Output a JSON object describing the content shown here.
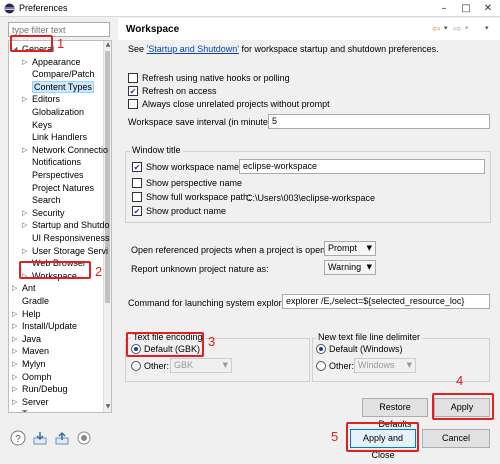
{
  "window": {
    "title": "Preferences",
    "controls": [
      "–",
      "□",
      "✕"
    ]
  },
  "filter": {
    "placeholder": "type filter text"
  },
  "tree": {
    "items": [
      {
        "label": "General",
        "indent": 0,
        "arrow": "◢",
        "selected": false,
        "annot": "1"
      },
      {
        "label": "Appearance",
        "indent": 1,
        "arrow": "▷"
      },
      {
        "label": "Compare/Patch",
        "indent": 1,
        "arrow": ""
      },
      {
        "label": "Content Types",
        "indent": 1,
        "arrow": "",
        "selected": true
      },
      {
        "label": "Editors",
        "indent": 1,
        "arrow": "▷"
      },
      {
        "label": "Globalization",
        "indent": 1,
        "arrow": ""
      },
      {
        "label": "Keys",
        "indent": 1,
        "arrow": ""
      },
      {
        "label": "Link Handlers",
        "indent": 1,
        "arrow": ""
      },
      {
        "label": "Network Connectio",
        "indent": 1,
        "arrow": "▷"
      },
      {
        "label": "Notifications",
        "indent": 1,
        "arrow": ""
      },
      {
        "label": "Perspectives",
        "indent": 1,
        "arrow": ""
      },
      {
        "label": "Project Natures",
        "indent": 1,
        "arrow": ""
      },
      {
        "label": "Search",
        "indent": 1,
        "arrow": ""
      },
      {
        "label": "Security",
        "indent": 1,
        "arrow": "▷"
      },
      {
        "label": "Startup and Shutdo",
        "indent": 1,
        "arrow": "▷"
      },
      {
        "label": "UI Responsiveness",
        "indent": 1,
        "arrow": ""
      },
      {
        "label": "User Storage Servi",
        "indent": 1,
        "arrow": "▷"
      },
      {
        "label": "Web Browser",
        "indent": 1,
        "arrow": ""
      },
      {
        "label": "Workspace",
        "indent": 1,
        "arrow": "▷",
        "annot": "2"
      },
      {
        "label": "Ant",
        "indent": 0,
        "arrow": "▷"
      },
      {
        "label": "Gradle",
        "indent": 0,
        "arrow": ""
      },
      {
        "label": "Help",
        "indent": 0,
        "arrow": "▷"
      },
      {
        "label": "Install/Update",
        "indent": 0,
        "arrow": "▷"
      },
      {
        "label": "Java",
        "indent": 0,
        "arrow": "▷"
      },
      {
        "label": "Maven",
        "indent": 0,
        "arrow": "▷"
      },
      {
        "label": "Mylyn",
        "indent": 0,
        "arrow": "▷"
      },
      {
        "label": "Oomph",
        "indent": 0,
        "arrow": "▷"
      },
      {
        "label": "Run/Debug",
        "indent": 0,
        "arrow": "▷"
      },
      {
        "label": "Server",
        "indent": 0,
        "arrow": "▷"
      },
      {
        "label": "Team",
        "indent": 0,
        "arrow": "▷"
      }
    ]
  },
  "page": {
    "title": "Workspace",
    "nav_icons": [
      "⇦",
      "▾",
      "⇨",
      "▾",
      "▾"
    ],
    "desc_prefix": "See ",
    "desc_link": "'Startup and Shutdown'",
    "desc_suffix": " for workspace startup and shutdown preferences.",
    "refresh_native": "Refresh using native hooks or polling",
    "refresh_access": "Refresh on access",
    "always_close": "Always close unrelated projects without prompt",
    "save_interval_label": "Workspace save interval (in minutes):",
    "save_interval_value": "5",
    "window_title_group": "Window title",
    "show_ws_name_label": "Show workspace name:",
    "show_ws_name_value": "eclipse-workspace",
    "show_perspective": "Show perspective name",
    "show_full_path_label": "Show full workspace path:",
    "show_full_path_value": "C:\\Users\\003\\eclipse-workspace",
    "show_product": "Show product name",
    "open_ref_label": "Open referenced projects when a project is opened:",
    "open_ref_value": "Prompt",
    "unknown_nature_label": "Report unknown project nature as:",
    "unknown_nature_value": "Warning",
    "cmd_label": "Command for launching system explorer:",
    "cmd_value": "explorer /E,/select=${selected_resource_loc}",
    "encoding_group": "Text file encoding",
    "encoding_default": "Default (GBK)",
    "encoding_other": "Other:",
    "encoding_other_value": "GBK",
    "delimiter_group": "New text file line delimiter",
    "delimiter_default": "Default (Windows)",
    "delimiter_other": "Other:",
    "delimiter_other_value": "Windows",
    "restore_defaults": "Restore Defaults",
    "apply": "Apply",
    "apply_close": "Apply and Close",
    "cancel": "Cancel"
  },
  "annotations": {
    "n1": "1",
    "n2": "2",
    "n3": "3",
    "n4": "4",
    "n5": "5"
  },
  "colors": {
    "annotation": "#e0211e",
    "selection": "#cce8ff",
    "link": "#0645ad"
  },
  "checkboxes": {
    "refresh_native": false,
    "refresh_access": true,
    "always_close": false,
    "show_ws_name": true,
    "show_perspective": false,
    "show_full_path": false,
    "show_product": true
  }
}
